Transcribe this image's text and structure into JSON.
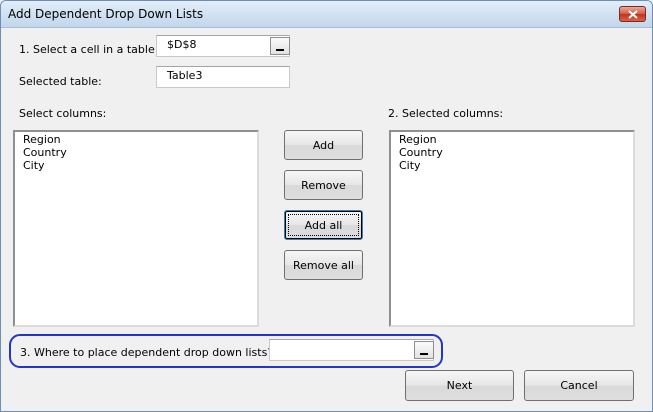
{
  "window": {
    "title": "Add Dependent Drop Down Lists"
  },
  "step1": {
    "label": "1. Select a cell in a table:",
    "value": "$D$8"
  },
  "selected_table": {
    "label": "Selected table:",
    "value": "Table3"
  },
  "select_columns": {
    "label": "Select columns:",
    "items": [
      "Region",
      "Country",
      "City"
    ]
  },
  "selected_columns": {
    "label": "2. Selected columns:",
    "items": [
      "Region",
      "Country",
      "City"
    ]
  },
  "buttons": {
    "add": "Add",
    "remove": "Remove",
    "add_all": "Add all",
    "remove_all": "Remove all",
    "next": "Next",
    "cancel": "Cancel"
  },
  "step3": {
    "label": "3. Where to place dependent drop down lists?",
    "value": ""
  },
  "colors": {
    "highlight": "#2536c4",
    "close_button": "#c3321c"
  }
}
